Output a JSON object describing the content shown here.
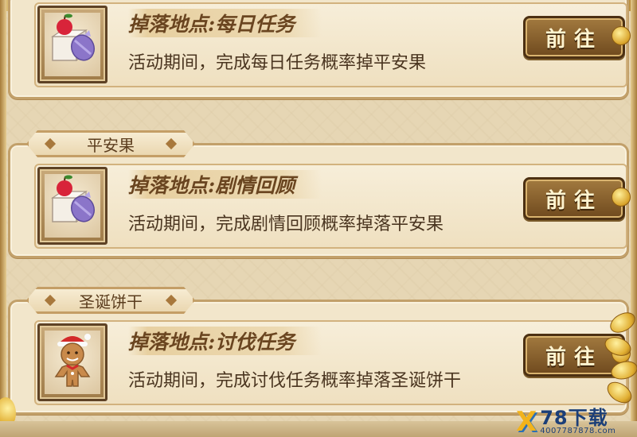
{
  "sections": [
    {
      "tag": "",
      "title": "掉落地点:每日任务",
      "desc": "活动期间，完成每日任务概率掉平安果",
      "button": "前往",
      "icon": "gift-apple-icon"
    },
    {
      "tag": "平安果",
      "title": "掉落地点:剧情回顾",
      "desc": "活动期间，完成剧情回顾概率掉落平安果",
      "button": "前往",
      "icon": "gift-apple-icon"
    },
    {
      "tag": "圣诞饼干",
      "title": "掉落地点:讨伐任务",
      "desc": "活动期间，完成讨伐任务概率掉落圣诞饼干",
      "button": "前往",
      "icon": "gingerbread-icon"
    }
  ],
  "watermark": {
    "brand": "78下载",
    "phone": "4007787878.com"
  },
  "colors": {
    "panel": "#f2e6cb",
    "border": "#c2a06a",
    "button": "#6f4a1e",
    "title_text": "#6a4520"
  }
}
